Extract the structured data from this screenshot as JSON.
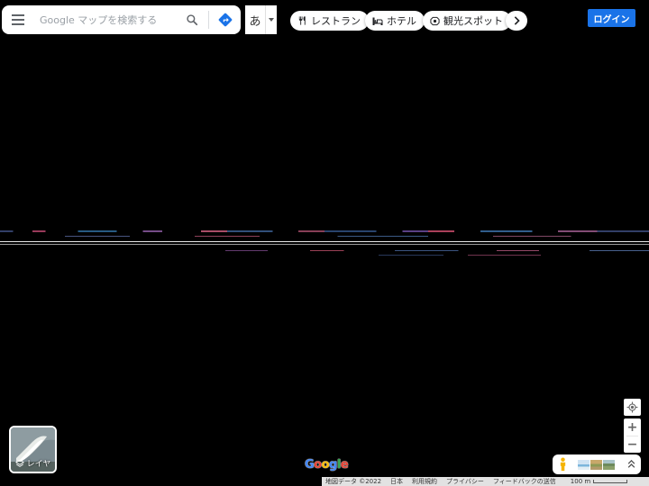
{
  "search": {
    "placeholder": "Google マップを検索する"
  },
  "input_tool": {
    "label": "あ"
  },
  "chips": [
    {
      "label": "レストラン",
      "icon": "fork-knife-icon"
    },
    {
      "label": "ホテル",
      "icon": "bed-icon"
    },
    {
      "label": "観光スポット",
      "icon": "camera-icon"
    }
  ],
  "login": {
    "label": "ログイン"
  },
  "layers": {
    "label": "レイヤ"
  },
  "logo": {
    "letters": [
      "G",
      "o",
      "o",
      "g",
      "l",
      "e"
    ],
    "colors": [
      "#4285f4",
      "#ea4335",
      "#fbbc05",
      "#4285f4",
      "#34a853",
      "#ea4335"
    ]
  },
  "zoom": {
    "in": "+",
    "out": "−"
  },
  "footer": {
    "attribution": "地図データ ©2022",
    "country": "日本",
    "terms": "利用規約",
    "privacy": "プライバシー",
    "feedback": "フィードバックの送信",
    "scale": "100 m"
  },
  "colors": {
    "accent": "#1a73e8",
    "map_background": "#000000"
  }
}
